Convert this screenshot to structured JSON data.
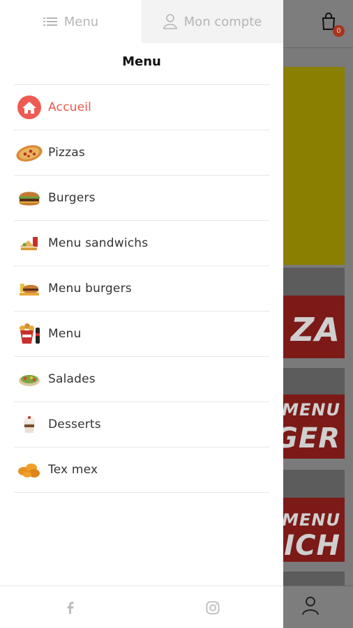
{
  "tabs": {
    "menu_label": "Menu",
    "account_label": "Mon compte"
  },
  "drawer": {
    "title": "Menu",
    "items": [
      {
        "label": "Accueil",
        "icon": "home-icon",
        "active": true
      },
      {
        "label": "Pizzas",
        "icon": "pizza-icon"
      },
      {
        "label": "Burgers",
        "icon": "burger-icon"
      },
      {
        "label": "Menu sandwichs",
        "icon": "sandwich-menu-icon"
      },
      {
        "label": "Menu burgers",
        "icon": "burger-menu-icon"
      },
      {
        "label": "Menu",
        "icon": "menu-bucket-icon"
      },
      {
        "label": "Salades",
        "icon": "salad-icon"
      },
      {
        "label": "Desserts",
        "icon": "dessert-icon"
      },
      {
        "label": "Tex mex",
        "icon": "nuggets-icon"
      }
    ]
  },
  "footer": {
    "facebook_icon": "facebook-icon",
    "instagram_icon": "instagram-icon"
  },
  "background": {
    "cart_count": "0",
    "promo_texts": [
      "ZA",
      "MENU",
      "GER",
      "MENU",
      "ICH"
    ]
  },
  "colors": {
    "accent": "#f0554b",
    "tab_text": "#b5b5b5",
    "divider": "#e6e6e6"
  }
}
